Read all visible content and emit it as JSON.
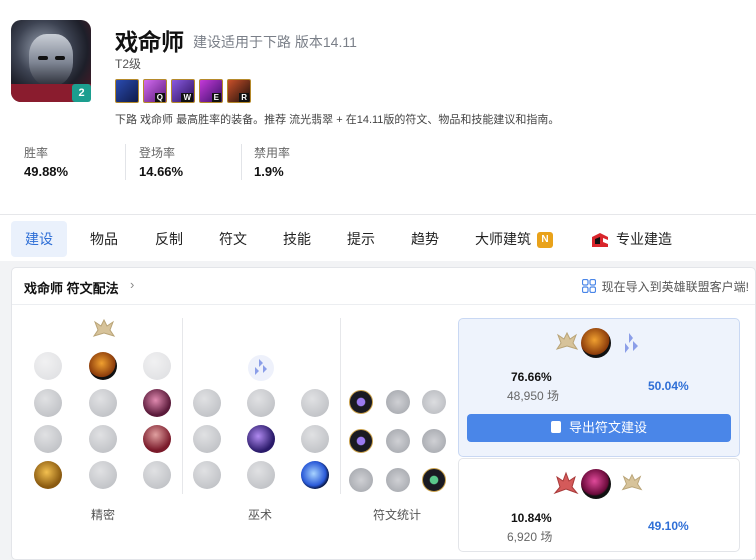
{
  "champion": {
    "name": "戏命师",
    "subtitle": "建设适用于下路 版本14.11",
    "tier": "T2级",
    "level_badge": "2",
    "description": "下路 戏命师 最高胜率的装备。推荐 流光翡翠 + 在14.11版的符文、物品和技能建议和指南。"
  },
  "abilities": [
    {
      "key": "",
      "color": "#1f3a8a"
    },
    {
      "key": "Q",
      "color": "#b03ac7"
    },
    {
      "key": "W",
      "color": "#5a2aa8"
    },
    {
      "key": "E",
      "color": "#6d23b8"
    },
    {
      "key": "R",
      "color": "#3a2318"
    }
  ],
  "stats": [
    {
      "label": "胜率",
      "value": "49.88%"
    },
    {
      "label": "登场率",
      "value": "14.66%"
    },
    {
      "label": "禁用率",
      "value": "1.9%"
    }
  ],
  "nav": {
    "tabs": [
      {
        "label": "建设",
        "active": true
      },
      {
        "label": "物品"
      },
      {
        "label": "反制"
      },
      {
        "label": "符文"
      },
      {
        "label": "技能"
      },
      {
        "label": "提示"
      },
      {
        "label": "趋势"
      },
      {
        "label": "大师建筑",
        "badge": "N"
      },
      {
        "label": "专业建造",
        "icon": "pro-build-icon"
      }
    ]
  },
  "rune_panel": {
    "title": "戏命师 符文配法",
    "import_label": "现在导入到英雄联盟客户端!",
    "column_labels": [
      "精密",
      "巫术",
      "符文统计"
    ],
    "export_label": "导出符文建设",
    "options": [
      {
        "pick_rate": "76.66%",
        "games": "48,950 场",
        "win_rate": "50.04%"
      },
      {
        "pick_rate": "10.84%",
        "games": "6,920 场",
        "win_rate": "49.10%"
      }
    ]
  },
  "colors": {
    "accent": "#2f6fd6",
    "export_button": "#4a86e8",
    "tier_badge": "#1c9e8f",
    "new_badge": "#e9a21a"
  }
}
